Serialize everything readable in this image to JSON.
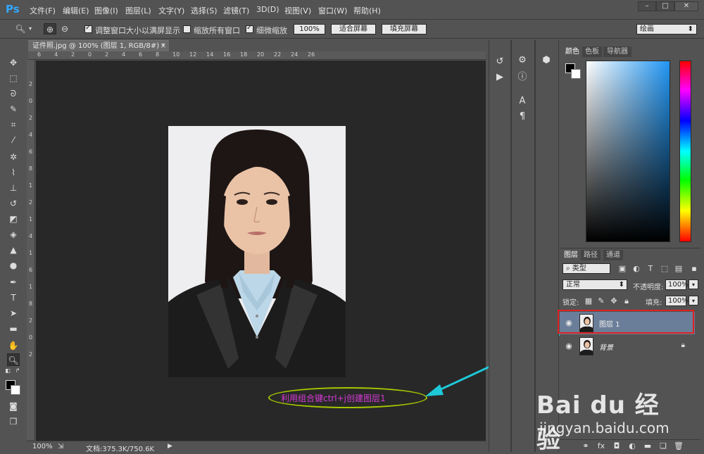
{
  "app": {
    "logo": "Ps"
  },
  "menubar": {
    "items": [
      "文件(F)",
      "编辑(E)",
      "图像(I)",
      "图层(L)",
      "文字(Y)",
      "选择(S)",
      "滤镜(T)",
      "3D(D)",
      "视图(V)",
      "窗口(W)",
      "帮助(H)"
    ],
    "window_buttons": [
      "–",
      "□",
      "✕"
    ]
  },
  "options": {
    "resize_windows_label": "调整窗口大小以满屏显示",
    "resize_windows_checked": true,
    "zoom_all_label": "缩放所有窗口",
    "zoom_all_checked": false,
    "scrubby_zoom_label": "细微缩放",
    "scrubby_zoom_checked": true,
    "zoom_value": "100%",
    "fit_screen_label": "适合屏幕",
    "fill_screen_label": "填充屏幕",
    "workspace": "绘画"
  },
  "document": {
    "tab_title": "证件照.jpg @ 100% (图层 1, RGB/8#) *",
    "ruler_h_ticks": [
      "6",
      "4",
      "2",
      "0",
      "2",
      "4",
      "6",
      "8",
      "10",
      "12",
      "14",
      "16",
      "18",
      "20",
      "22",
      "24",
      "26"
    ],
    "ruler_v_ticks": [
      "2",
      "0",
      "2",
      "4",
      "6",
      "8",
      "1",
      "2",
      "1",
      "4",
      "1",
      "6",
      "1",
      "8",
      "2",
      "0",
      "2"
    ],
    "status_zoom": "100%",
    "status_doc": "文档:375.3K/750.6K"
  },
  "annotation": {
    "text": "利用组合键ctrl+j创建图层1",
    "ellipse_color": "#a5c700",
    "text_color": "#d63ad6",
    "arrow_color": "#1ec8d8"
  },
  "color_panel": {
    "tabs": [
      "颜色",
      "色板",
      "导航器"
    ],
    "active_tab": "颜色",
    "foreground": "#000000",
    "background": "#ffffff",
    "field_hue": "#2196f3"
  },
  "layers_panel": {
    "tabs": [
      "图层",
      "路径",
      "通道"
    ],
    "active_tab": "图层",
    "filter_kind": "类型",
    "blend_mode": "正常",
    "opacity_label": "不透明度:",
    "opacity_value": "100%",
    "lock_label": "锁定:",
    "fill_label": "填充:",
    "fill_value": "100%",
    "layers": [
      {
        "name": "图层 1",
        "selected": true,
        "locked": false
      },
      {
        "name": "背景",
        "selected": false,
        "locked": true
      }
    ],
    "highlight_color": "#e02020"
  },
  "watermark": {
    "brand": "Bai du 经验",
    "url": "jingyan.baidu.com"
  }
}
